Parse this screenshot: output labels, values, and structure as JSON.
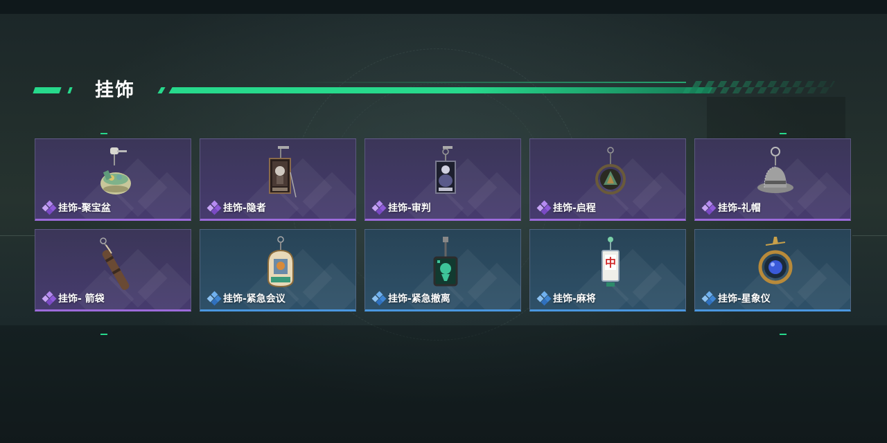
{
  "section": {
    "title": "挂饰"
  },
  "colors": {
    "accent": "#27d98c",
    "rarity_purple": "#9c6bdb",
    "rarity_blue": "#4a97e0"
  },
  "items": [
    {
      "name": "挂饰-聚宝盆",
      "rarity": "purple",
      "icon": "treasure-bowl-icon"
    },
    {
      "name": "挂饰-隐者",
      "rarity": "purple",
      "icon": "hermit-card-icon"
    },
    {
      "name": "挂饰-审判",
      "rarity": "purple",
      "icon": "judgement-card-icon"
    },
    {
      "name": "挂饰-启程",
      "rarity": "purple",
      "icon": "departure-emblem-icon"
    },
    {
      "name": "挂饰-礼帽",
      "rarity": "purple",
      "icon": "top-hat-icon"
    },
    {
      "name": "挂饰- 箭袋",
      "rarity": "purple",
      "icon": "quiver-icon"
    },
    {
      "name": "挂饰-紧急会议",
      "rarity": "blue",
      "icon": "emergency-meeting-icon"
    },
    {
      "name": "挂饰-紧急撤离",
      "rarity": "blue",
      "icon": "emergency-evacuation-icon"
    },
    {
      "name": "挂饰-麻将",
      "rarity": "blue",
      "icon": "mahjong-tile-icon"
    },
    {
      "name": "挂饰-星象仪",
      "rarity": "blue",
      "icon": "orrery-icon"
    }
  ]
}
